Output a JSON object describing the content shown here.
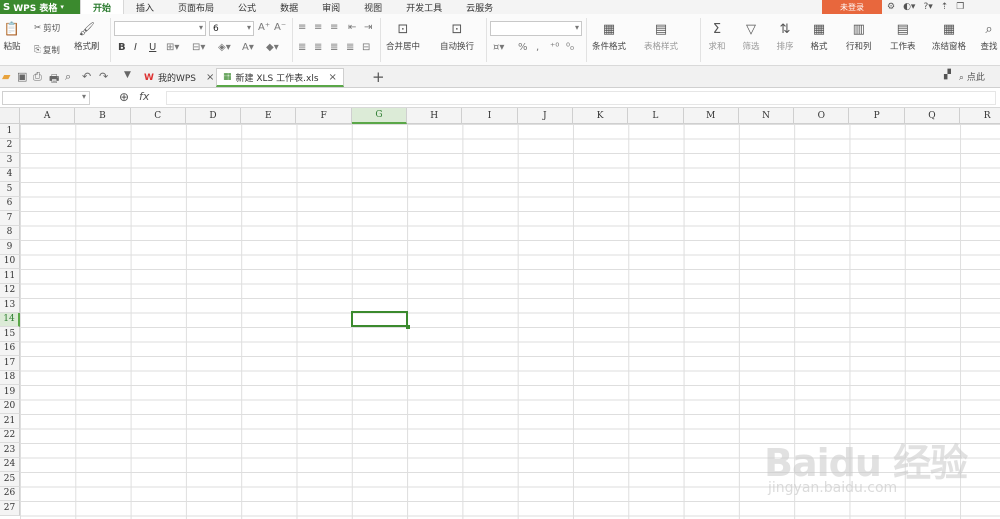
{
  "app": {
    "logo": "S",
    "name": "WPS 表格"
  },
  "menu": {
    "tabs": [
      "开始",
      "插入",
      "页面布局",
      "公式",
      "数据",
      "审阅",
      "视图",
      "开发工具",
      "云服务"
    ],
    "active": "开始",
    "login_label": "未登录"
  },
  "ribbon": {
    "paste": "粘贴",
    "cut": "剪切",
    "copy": "复制",
    "format_painter": "格式刷",
    "font_name": "",
    "font_size": "6",
    "bold": "B",
    "italic": "I",
    "underline": "U",
    "merge_center": "合并居中",
    "wrap_text": "自动换行",
    "number_format": "",
    "percent": "%",
    "conditional_format": "条件格式",
    "table_style": "表格样式",
    "sum": "求和",
    "filter": "筛选",
    "sort": "排序",
    "format": "格式",
    "row_col": "行和列",
    "worksheet": "工作表",
    "freeze": "冻结窗格",
    "find": "查找"
  },
  "tabs": {
    "wps_tab": "我的WPS",
    "doc_tab": "新建 XLS 工作表.xls",
    "right_label": "点此"
  },
  "formula": {
    "fx": "fx",
    "cell_ref": "",
    "value": ""
  },
  "grid": {
    "columns": [
      "A",
      "B",
      "C",
      "D",
      "E",
      "F",
      "G",
      "H",
      "I",
      "J",
      "K",
      "L",
      "M",
      "N",
      "O",
      "P",
      "Q",
      "R"
    ],
    "rows": [
      "1",
      "2",
      "3",
      "4",
      "5",
      "6",
      "7",
      "8",
      "9",
      "10",
      "11",
      "12",
      "13",
      "14",
      "15",
      "16",
      "17",
      "18",
      "19",
      "20",
      "21",
      "22",
      "23",
      "24",
      "25",
      "26",
      "27"
    ],
    "selected_column": "G",
    "selected_row": "14"
  },
  "watermark": {
    "brand": "Baidu 经验",
    "url": "jingyan.baidu.com"
  }
}
